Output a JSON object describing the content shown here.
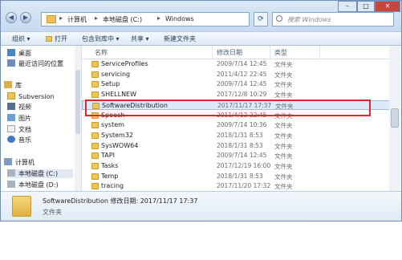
{
  "address": {
    "crumbs": [
      "计算机",
      "本地磁盘 (C:)",
      "Windows"
    ],
    "search_placeholder": "搜索 Windows"
  },
  "toolbar": {
    "organize": "组织 ▾",
    "open": "打开",
    "include_in_library": "包含到库中 ▾",
    "share": "共享 ▾",
    "new_folder": "新建文件夹"
  },
  "nav": {
    "items": [
      {
        "label": "桌面",
        "icon": "desktop-icon"
      },
      {
        "label": "最近访问的位置",
        "icon": "recent-places-icon"
      },
      {
        "label": "库",
        "icon": "library-icon"
      },
      {
        "label": "Subversion",
        "icon": "folder-icon"
      },
      {
        "label": "视频",
        "icon": "video-icon"
      },
      {
        "label": "图片",
        "icon": "pictures-icon"
      },
      {
        "label": "文档",
        "icon": "documents-icon"
      },
      {
        "label": "音乐",
        "icon": "music-icon"
      },
      {
        "label": "计算机",
        "icon": "computer-icon"
      },
      {
        "label": "本地磁盘 (C:)",
        "icon": "drive-icon"
      },
      {
        "label": "本地磁盘 (D:)",
        "icon": "drive-icon"
      }
    ]
  },
  "columns": {
    "name": "名称",
    "date": "修改日期",
    "type": "类型"
  },
  "files": [
    {
      "name": "ServiceProfiles",
      "date": "2009/7/14 12:45",
      "type": "文件夹"
    },
    {
      "name": "servicing",
      "date": "2011/4/12 22:45",
      "type": "文件夹"
    },
    {
      "name": "Setup",
      "date": "2009/7/14 12:45",
      "type": "文件夹"
    },
    {
      "name": "SHELLNEW",
      "date": "2017/12/8 10:29",
      "type": "文件夹"
    },
    {
      "name": "SoftwareDistribution",
      "date": "2017/11/17 17:37",
      "type": "文件夹"
    },
    {
      "name": "Speech",
      "date": "2011/4/12 22:45",
      "type": "文件夹"
    },
    {
      "name": "system",
      "date": "2009/7/14 10:36",
      "type": "文件夹"
    },
    {
      "name": "System32",
      "date": "2018/1/31 8:53",
      "type": "文件夹"
    },
    {
      "name": "SysWOW64",
      "date": "2018/1/31 8:53",
      "type": "文件夹"
    },
    {
      "name": "TAPI",
      "date": "2009/7/14 12:45",
      "type": "文件夹"
    },
    {
      "name": "Tasks",
      "date": "2017/12/19 16:00",
      "type": "文件夹"
    },
    {
      "name": "Temp",
      "date": "2018/1/31 8:53",
      "type": "文件夹"
    },
    {
      "name": "tracing",
      "date": "2017/11/20 17:32",
      "type": "文件夹"
    }
  ],
  "details": {
    "name_line": "SoftwareDistribution  修改日期: 2017/11/17 17:37",
    "type": "文件夹"
  },
  "colors": {
    "highlight_box": "#e0282b",
    "selection": "#dbe9f8"
  }
}
